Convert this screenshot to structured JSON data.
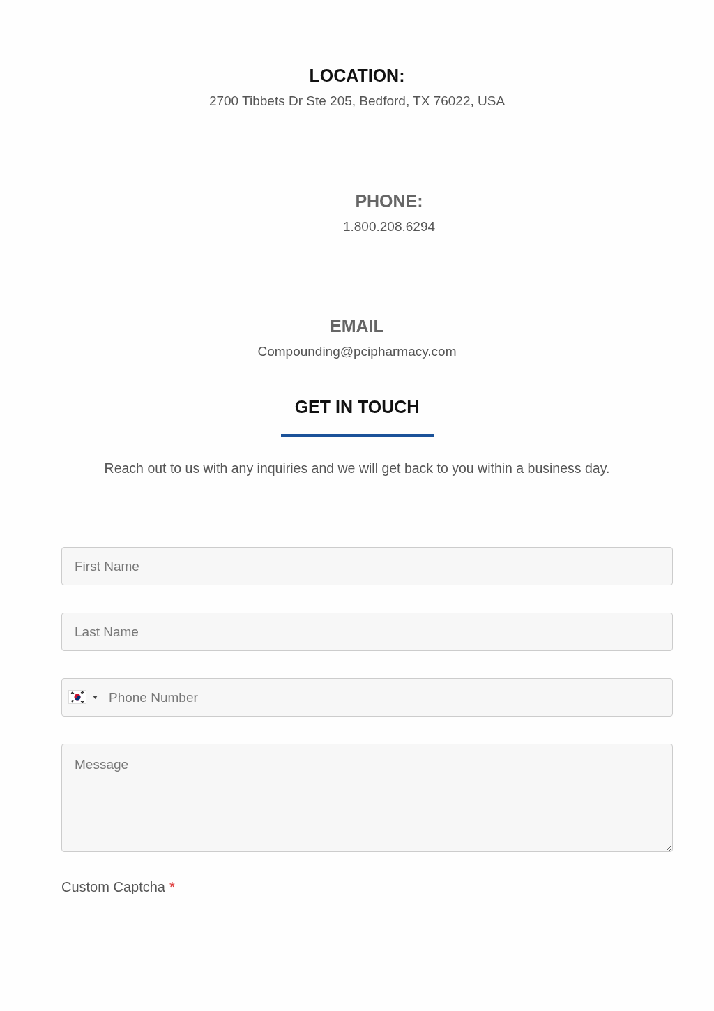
{
  "contacts": [
    {
      "heading": "LOCATION:",
      "kind": "primary",
      "value": "2700 Tibbets Dr Ste 205, Bedford, TX 76022, USA"
    },
    {
      "heading": "PHONE:",
      "kind": "secondary",
      "value": "1.800.208.6294"
    },
    {
      "heading": "EMAIL",
      "kind": "secondary",
      "value": "Compounding@pcipharmacy.com"
    }
  ],
  "section": {
    "title": "GET IN TOUCH",
    "intro": "Reach out to us with any inquiries and we will get back to you within a business day."
  },
  "form": {
    "fields": [
      {
        "kind": "text",
        "placeholder": "First Name"
      },
      {
        "kind": "text",
        "placeholder": "Last Name"
      },
      {
        "kind": "phone",
        "placeholder": "Phone Number"
      },
      {
        "kind": "textarea",
        "placeholder": "Message"
      }
    ],
    "captcha": {
      "label": "Custom Captcha",
      "required_mark": "*"
    }
  }
}
